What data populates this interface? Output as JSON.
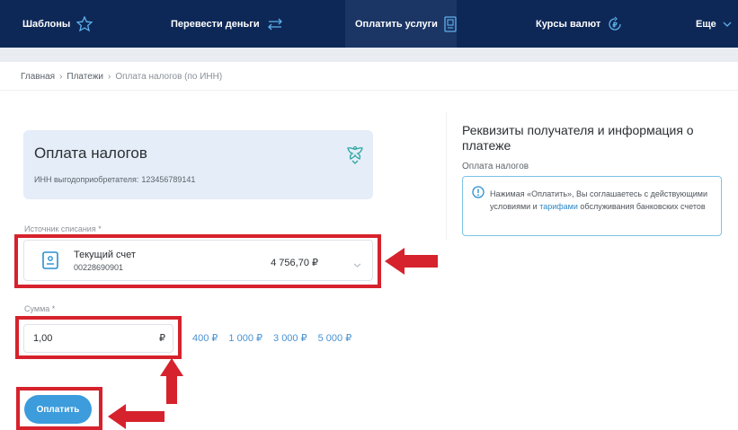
{
  "colors": {
    "nav_bg": "#0d2857",
    "accent_blue": "#3c9cdc",
    "annotation_red": "#d6222c"
  },
  "nav": {
    "items": [
      {
        "label": "Шаблоны",
        "icon": "star-icon"
      },
      {
        "label": "Перевести деньги",
        "icon": "transfer-arrows-icon"
      },
      {
        "label": "Оплатить услуги",
        "icon": "receipt-icon",
        "active": true
      },
      {
        "label": "Курсы валют",
        "icon": "currency-ruble-icon"
      },
      {
        "label": "Еще",
        "icon": "chevron-down-icon"
      }
    ]
  },
  "breadcrumb": [
    "Главная",
    "›",
    "Платежи",
    "›",
    "Оплата налогов (по ИНН)"
  ],
  "tax_card": {
    "title": "Оплата налогов",
    "inn_label": "ИНН выгодоприобретателя:",
    "inn_value": "123456789141",
    "emblem_icon": "double-eagle-emblem-icon"
  },
  "source": {
    "label": "Источник списания *",
    "account_name": "Текущий счет",
    "account_number": "00228690901",
    "balance": "4 756,70 ₽"
  },
  "amount": {
    "label": "Сумма *",
    "value": "1,00",
    "currency": "₽",
    "quick": [
      "400 ₽",
      "1 000 ₽",
      "3 000 ₽",
      "5 000 ₽"
    ]
  },
  "pay_button": "Оплатить",
  "details": {
    "title": "Реквизиты получателя и информация о платеже",
    "subtitle": "Оплата налогов",
    "notice_before": "Нажимая «Оплатить», Вы соглашаетесь с действующими условиями и",
    "notice_link": "тарифами",
    "notice_after": "обслуживания банковских счетов"
  }
}
